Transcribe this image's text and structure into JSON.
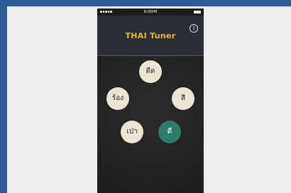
{
  "status_bar": {
    "time": "6:00PM"
  },
  "header": {
    "title": "THAI Tuner",
    "info_icon": "info-icon",
    "info_glyph": "i"
  },
  "tones": {
    "top": "ตีด",
    "left": "ร้อง",
    "right": "สี",
    "bottom_left": "เป่า",
    "bottom_right": "ดี"
  },
  "colors": {
    "title": "#f0b820",
    "active_tone": "#2e7d6a",
    "tone": "#ece5d4",
    "background": "#2f5a9a"
  },
  "selected_tone": "bottom_right"
}
